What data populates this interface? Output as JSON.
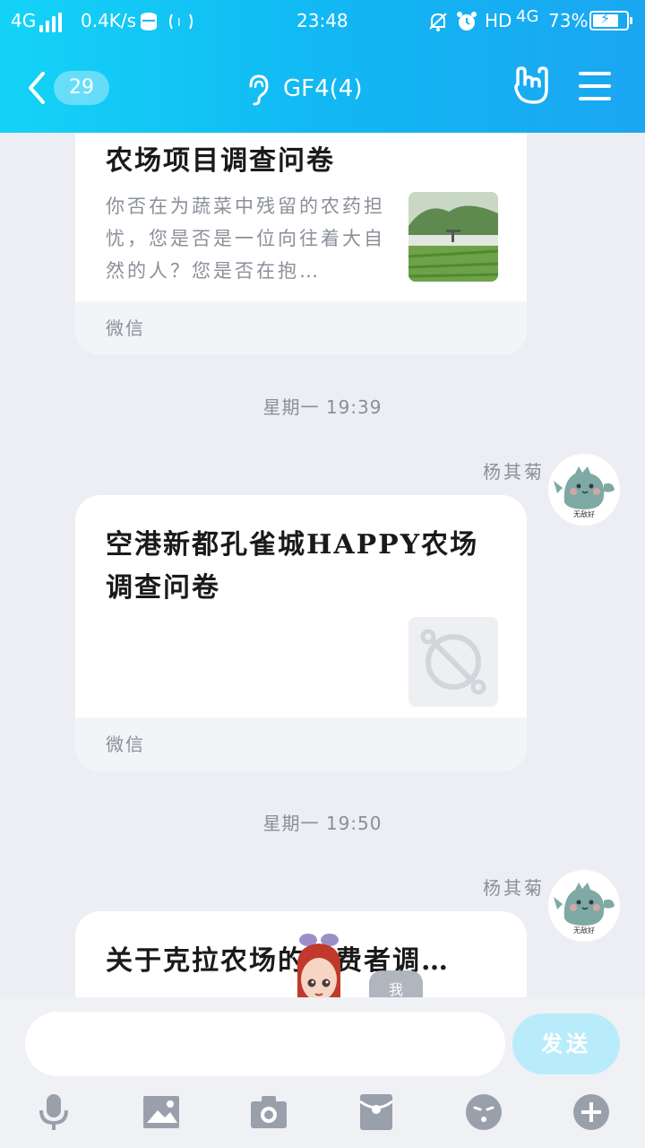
{
  "status_bar": {
    "network": "4G",
    "speed": "0.4K/s",
    "time": "23:48",
    "hd": "HD",
    "network_right": "4G",
    "battery": "73%"
  },
  "nav": {
    "unread_count": "29",
    "title": "GF4(4)"
  },
  "messages": [
    {
      "title": "农场项目调查问卷",
      "description": "你否在为蔬菜中残留的农药担忧，您是否是一位向往着大自然的人？您是否在抱…",
      "source": "微信"
    },
    {
      "time": "星期一 19:39",
      "sender": "杨其菊",
      "title_line1": "空港新都孔雀城HAPPY农场",
      "title_line2": "调查问卷",
      "source": "微信",
      "avatar_caption": "无敌好"
    },
    {
      "time": "星期一 19:50",
      "sender": "杨其菊",
      "title": "关于克拉农场的消费者调…",
      "avatar_caption": "无敌好"
    }
  ],
  "input": {
    "placeholder": "",
    "send_label": "发送"
  },
  "floating": {
    "me_label": "我"
  },
  "colors": {
    "header_start": "#14d3f7",
    "header_end": "#1aa6f1",
    "send_button": "#b9ecfb",
    "background": "#eceef3"
  }
}
